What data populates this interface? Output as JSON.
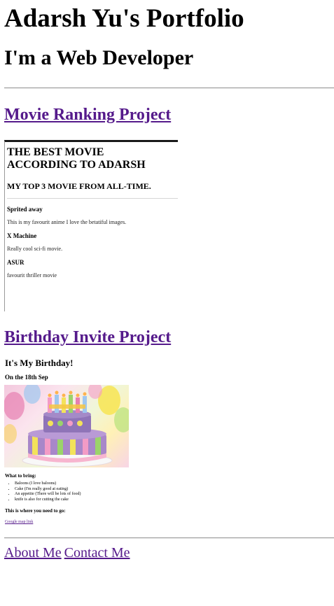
{
  "header": {
    "title": "Adarsh Yu's Portfolio",
    "subtitle": "I'm a Web Developer"
  },
  "projects": [
    {
      "link_label": "Movie Ranking Project"
    },
    {
      "link_label": "Birthday Invite Project"
    }
  ],
  "movie_frame": {
    "heading": "THE BEST MOVIE ACCORDING TO ADARSH",
    "subheading": "MY TOP 3 MOVIE FROM ALL-TIME.",
    "movies": [
      {
        "name": "Sprited away",
        "description": "This is my favourit anime I love the betatiful images."
      },
      {
        "name": "X Machine",
        "description": "Really cool sci-fi movie."
      },
      {
        "name": "ASUR",
        "description": "favourit thriller movie"
      }
    ]
  },
  "birthday_frame": {
    "heading": "It's My Birthday!",
    "date": "On the 18th Sep",
    "cake_image": {
      "icon": "birthday-cake-image",
      "colors": {
        "cake": "#a887c9",
        "frosting": "#f3a6c4",
        "base": "#f7c9d9"
      }
    },
    "bring_heading": "What to bring:",
    "bring_items": [
      "Baloons (I love baloons)",
      "Cake (I'm really good at eating)",
      "An appetite (There will be lots of food)",
      "knife is also for cutting the cake"
    ],
    "where_heading": "This is where you need to go:",
    "map_link": "Google map link"
  },
  "footer": {
    "about_label": "About Me",
    "contact_label": "Contact Me"
  },
  "colors": {
    "link": "#551a8b",
    "text": "#000000",
    "rule": "#9a9a9a"
  }
}
